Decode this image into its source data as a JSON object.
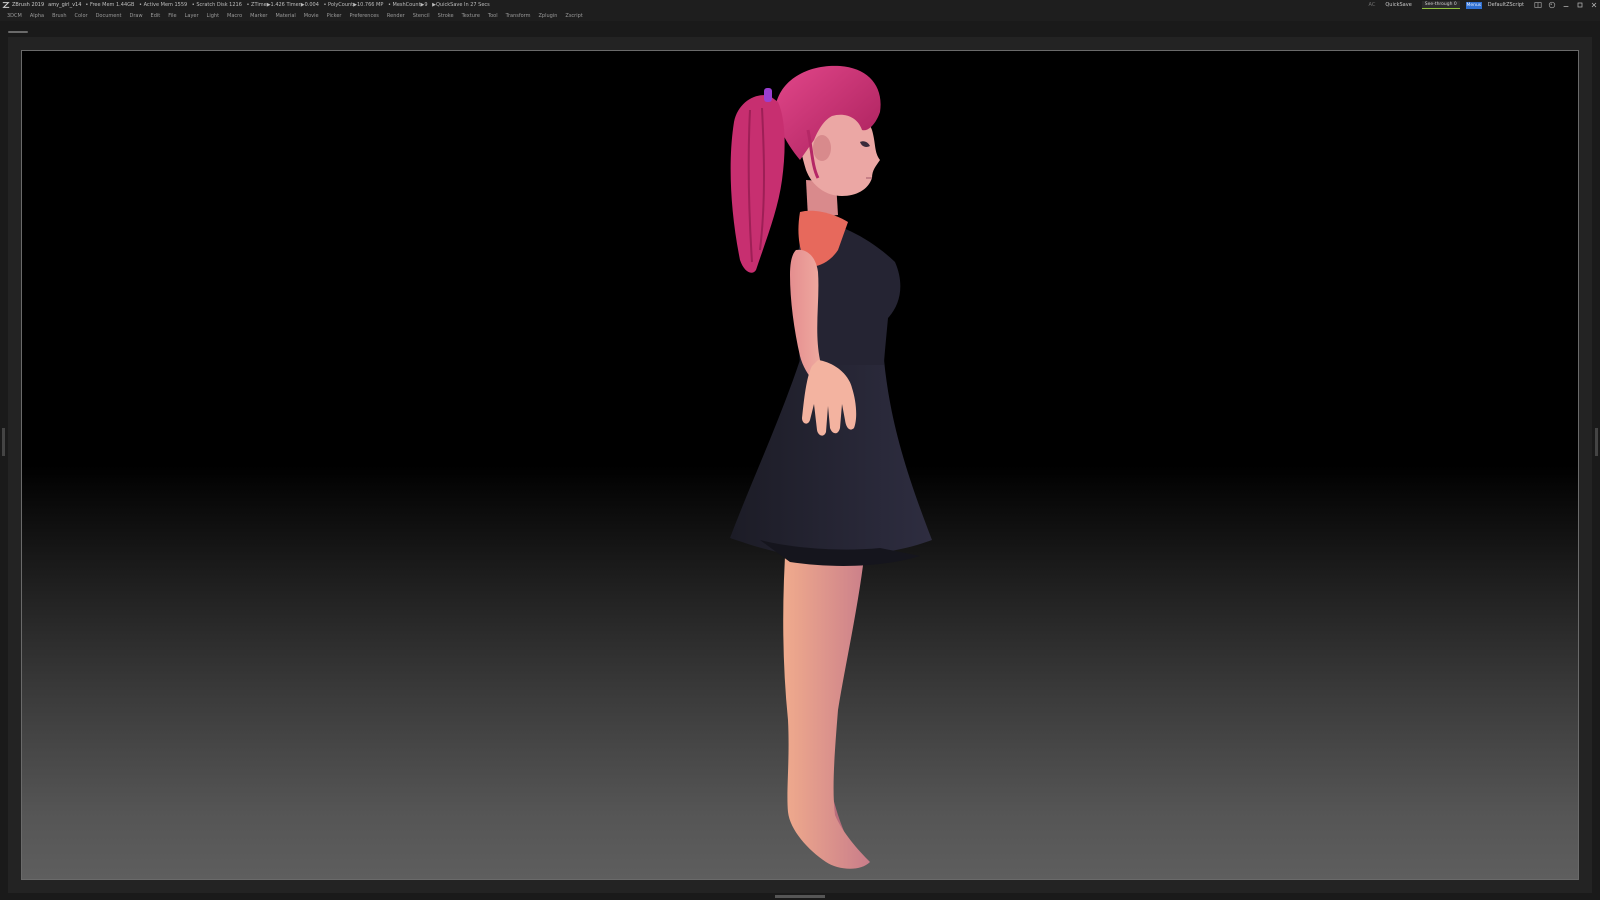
{
  "titlebar": {
    "app_name": "ZBrush 2019",
    "document": "amy_girl_v14",
    "stats": [
      "• Free Mem 1.44GB",
      "• Active Mem 1559",
      "• Scratch Disk 1216",
      "• ZTime▶1.426 Timer▶0.004",
      "• PolyCount▶10.766 MP",
      "• MeshCount▶9",
      "▶QuickSave In 27 Secs"
    ],
    "right": {
      "ac": "AC",
      "quicksave": "QuickSave",
      "see_through": "See-through  0",
      "menus": "Menus",
      "script": "DefaultZScript"
    }
  },
  "menubar": {
    "items": [
      "3DCM",
      "Alpha",
      "Brush",
      "Color",
      "Document",
      "Draw",
      "Edit",
      "File",
      "Layer",
      "Light",
      "Macro",
      "Marker",
      "Material",
      "Movie",
      "Picker",
      "Preferences",
      "Render",
      "Stencil",
      "Stroke",
      "Texture",
      "Tool",
      "Transform",
      "Zplugin",
      "Zscript"
    ]
  },
  "colors": {
    "hair": "#c0306e",
    "skin": "#e9a3a0",
    "dress": "#1d1d2a",
    "top": "#e56a5e",
    "hair_tie": "#9a3fd0"
  },
  "icons": [
    "zbrush-logo-icon",
    "layout-icon",
    "palette-icon",
    "minimize-icon",
    "restore-icon",
    "close-icon"
  ]
}
